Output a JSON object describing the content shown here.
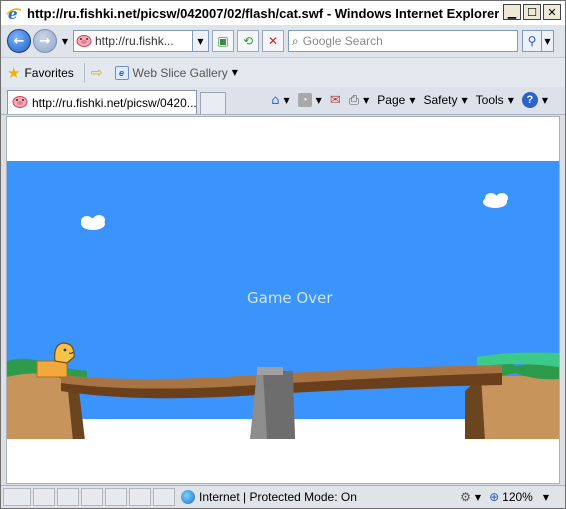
{
  "window": {
    "title": "http://ru.fishki.net/picsw/042007/02/flash/cat.swf - Windows Internet Explorer",
    "minimize": "▁",
    "maximize": "☐",
    "close": "✕"
  },
  "address_bar": {
    "url": "http://ru.fishk...",
    "search_placeholder": "Google Search"
  },
  "favorites_bar": {
    "favorites_label": "Favorites",
    "web_slice_label": "Web Slice Gallery"
  },
  "tabs": [
    {
      "label": "http://ru.fishki.net/picsw/0420..."
    }
  ],
  "command_bar": {
    "page": "Page",
    "safety": "Safety",
    "tools": "Tools"
  },
  "game": {
    "status_text": "Game Over"
  },
  "status_bar": {
    "zone_text": "Internet | Protected Mode: On",
    "zoom_level": "120%"
  },
  "icons": {
    "title": "ie-logo-icon",
    "back": "back-arrow-icon",
    "forward": "forward-arrow-icon",
    "site": "pig-favicon-icon",
    "compat": "compatibility-view-icon",
    "refresh": "refresh-icon",
    "stop": "stop-icon",
    "search": "search-icon",
    "home": "home-icon",
    "feeds": "rss-feed-icon",
    "mail": "mail-icon",
    "print": "printer-icon",
    "help": "help-icon",
    "globe": "internet-zone-icon"
  },
  "colors": {
    "sky": "#3a94fb",
    "grass": "#2e9b4a",
    "bridge": "#8a5a2e",
    "ground": "#c7955c"
  }
}
